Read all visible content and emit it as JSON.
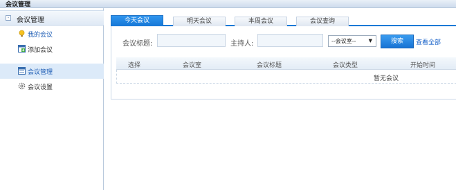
{
  "window": {
    "title": "会议管理"
  },
  "sidebar": {
    "group_label": "会议管理",
    "group_toggle": "-",
    "items": [
      {
        "label": "我的会议",
        "icon": "bulb-icon"
      },
      {
        "label": "添加会议",
        "icon": "add-meeting-icon"
      },
      {
        "label": "会议管理",
        "icon": "manage-meeting-icon"
      },
      {
        "label": "会议设置",
        "icon": "gear-icon"
      }
    ]
  },
  "tabs": [
    {
      "label": "今天会议",
      "active": true
    },
    {
      "label": "明天会议",
      "active": false
    },
    {
      "label": "本周会议",
      "active": false
    },
    {
      "label": "会议查询",
      "active": false
    }
  ],
  "filters": {
    "title_label": "会议标题:",
    "title_value": "",
    "host_label": "主持人:",
    "host_value": "",
    "room_select": "--会议室--",
    "search_button": "搜索",
    "view_all_link": "查看全部"
  },
  "table": {
    "columns": [
      "选择",
      "会议室",
      "会议标题",
      "会议类型",
      "开始时间"
    ],
    "empty_text": "暂无会议"
  },
  "colors": {
    "accent": "#1a79d6",
    "link": "#1a63c9"
  }
}
